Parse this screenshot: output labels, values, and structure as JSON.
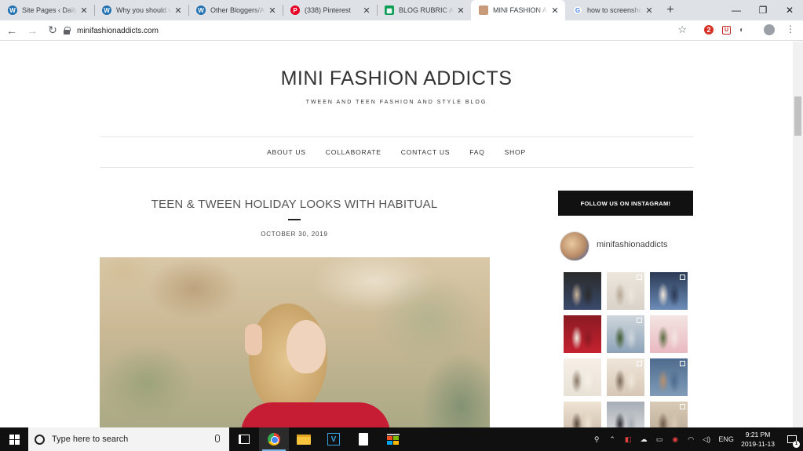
{
  "browser": {
    "tabs": [
      {
        "title": "Site Pages ‹ Daily T",
        "favicon": "wordpress-icon",
        "active": false
      },
      {
        "title": "Why you should w",
        "favicon": "wordpress-icon",
        "active": false
      },
      {
        "title": "Other Bloggers/Au",
        "favicon": "wordpress-icon",
        "active": false
      },
      {
        "title": "(338) Pinterest",
        "favicon": "pinterest-icon",
        "active": false
      },
      {
        "title": "BLOG RUBRIC AND",
        "favicon": "google-sheets-icon",
        "active": false
      },
      {
        "title": "MINI FASHION ADD",
        "favicon": "site-favicon-icon",
        "active": true
      },
      {
        "title": "how to screenshot o",
        "favicon": "google-icon",
        "active": false
      }
    ],
    "url": "minifashionaddicts.com",
    "extension_badge": "2"
  },
  "site": {
    "title": "MINI FASHION ADDICTS",
    "tagline": "TWEEN AND TEEN FASHION AND STYLE BLOG",
    "nav": [
      "ABOUT US",
      "COLLABORATE",
      "CONTACT US",
      "FAQ",
      "SHOP"
    ]
  },
  "post": {
    "title": "TEEN & TWEEN HOLIDAY LOOKS WITH HABITUAL",
    "date": "OCTOBER 30, 2019"
  },
  "sidebar": {
    "button": "FOLLOW US ON INSTAGRAM!",
    "username": "minifashionaddicts",
    "grid_count": 12
  },
  "taskbar": {
    "search_placeholder": "Type here to search",
    "language": "ENG",
    "time": "9:21 PM",
    "date": "2019-11-13",
    "notification_count": "1"
  }
}
